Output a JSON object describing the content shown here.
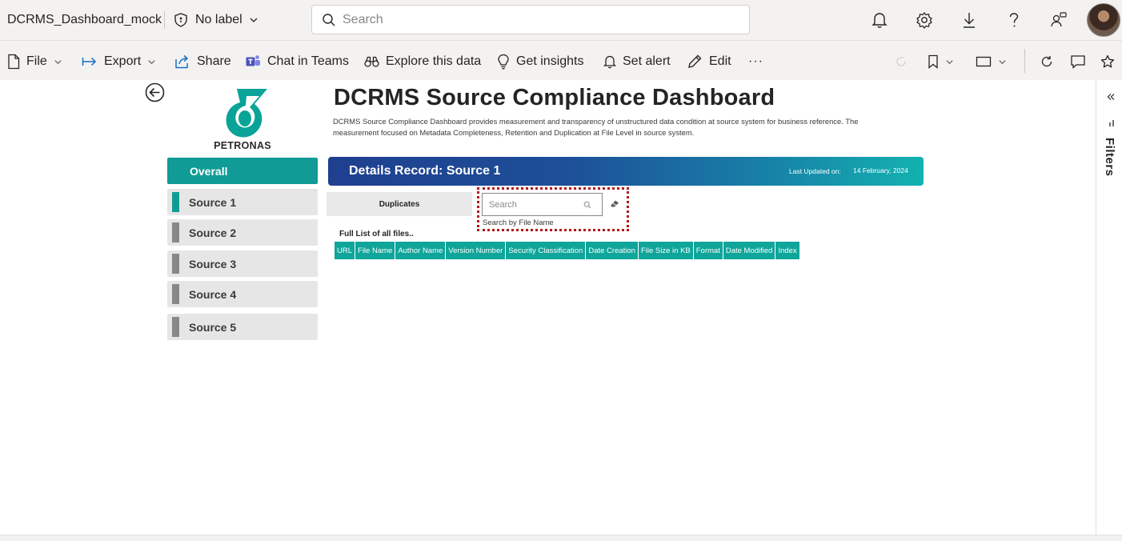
{
  "app": {
    "report_title": "DCRMS_Dashboard_mock",
    "sensitivity_label": "No label",
    "search_placeholder": "Search"
  },
  "toolbar": {
    "file": "File",
    "export": "Export",
    "share": "Share",
    "chat_in_teams": "Chat in Teams",
    "explore": "Explore this data",
    "insights": "Get insights",
    "set_alert": "Set alert",
    "edit": "Edit",
    "more": "···"
  },
  "right_pane": {
    "filters_label": "Filters"
  },
  "report": {
    "logo_text": "PETRONAS",
    "title": "DCRMS Source Compliance Dashboard",
    "description": "DCRMS Source Compliance Dashboard provides measurement and transparency of unstructured data condition at source system for business reference. The measurement focused on Metadata Completeness, Retention and Duplication at File Level in source system.",
    "nav": [
      "Overall",
      "Source 1",
      "Source 2",
      "Source 3",
      "Source 4",
      "Source 5"
    ],
    "banner_title": "Details Record: Source 1",
    "last_updated_label": "Last Updated on:",
    "last_updated_date": "14 February, 2024",
    "duplicates_button": "Duplicates",
    "file_search_placeholder": "Search",
    "file_search_hint": "Search by File Name",
    "list_title": "Full List of all files..",
    "columns": [
      "URL",
      "File Name",
      "Author Name",
      "Version Number",
      "Security Classification",
      "Date Creation",
      "File Size in KB",
      "Format",
      "Date Modified",
      "Index"
    ]
  },
  "colors": {
    "accent_teal": "#109b96",
    "table_header": "#0fa59a",
    "banner_start": "#1f3f8f",
    "banner_end": "#13b2b0",
    "highlight_box": "#b01818"
  }
}
